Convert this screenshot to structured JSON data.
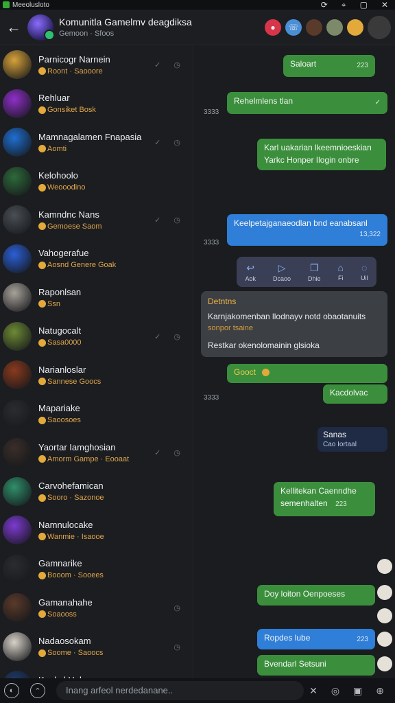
{
  "statusbar": {
    "app_title": "Meeolusloto"
  },
  "header": {
    "title": "Komunitla Gamelmv deagdiksa",
    "subtitle": "Gemoon · Sfoos",
    "back_icon": "arrow-left-icon"
  },
  "sidebar": {
    "chats": [
      {
        "name": "Parnicogr Narnein",
        "meta": "Roont · Saooore",
        "avatar": "#d7a23a",
        "time_icons": "✓ ◷"
      },
      {
        "name": "Rehluar",
        "meta": "Gonsiket Bosk",
        "avatar": "#8f2fc9",
        "time_icons": ""
      },
      {
        "name": "Mamnagalamen Fnapasia",
        "meta": "Aomti",
        "avatar": "#1f6fd1",
        "time_icons": "✓ ◷"
      },
      {
        "name": "Kelohoolo",
        "meta": "Weooodino",
        "avatar": "#2d6a3a",
        "time_icons": ""
      },
      {
        "name": "Kamndnc Nans",
        "meta": "Gemoese Saom",
        "avatar": "#4a4f55",
        "time_icons": "✓ ◷"
      },
      {
        "name": "Vahogerafue",
        "meta": "Aosnd Genere Goak",
        "avatar": "#2c5fd6",
        "time_icons": ""
      },
      {
        "name": "Raponlsan",
        "meta": "Ssn",
        "avatar": "#a8a29a",
        "time_icons": ""
      },
      {
        "name": "Natugocalt",
        "meta": "Sasa0000",
        "avatar": "#6d8a35",
        "time_icons": "✓ ◷"
      },
      {
        "name": "Narianloslar",
        "meta": "Sannese Goocs",
        "avatar": "#8a3a1e",
        "time_icons": ""
      },
      {
        "name": "Mapariake",
        "meta": "Saoosoes",
        "avatar": "#2a2c30",
        "time_icons": ""
      },
      {
        "name": "Yaortar Iamghosian",
        "meta": "Amorm Gampe · Eooaat",
        "avatar": "#3a2e2a",
        "time_icons": "✓ ◷"
      },
      {
        "name": "Carvohefamican",
        "meta": "Sooro · Sazonoe",
        "avatar": "#2f8f6a",
        "time_icons": ""
      },
      {
        "name": "Namnulocake",
        "meta": "Wanmie · Isaooe",
        "avatar": "#7d3ad1",
        "time_icons": ""
      },
      {
        "name": "Gamnarike",
        "meta": "Booom · Sooees",
        "avatar": "#2a2c30",
        "time_icons": ""
      },
      {
        "name": "Gamanahahe",
        "meta": "Soaooss",
        "avatar": "#5a3a2a",
        "time_icons": "◷"
      },
      {
        "name": "Nadaosokam",
        "meta": "Soome · Saoocs",
        "avatar": "#d8d2c8",
        "time_icons": "◷"
      },
      {
        "name": "Kaokal Hake",
        "meta": "",
        "avatar": "#1e3a6a",
        "time_icons": ""
      }
    ]
  },
  "conversation": {
    "messages": [
      {
        "text": "Saloart",
        "time": "223",
        "style": "green"
      },
      {
        "text": "Rehelmlens tlan",
        "time": "",
        "style": "green",
        "side_time": "3333"
      },
      {
        "text": "Karl uakarian lkeemnioeskian",
        "text2": "Yarkc Honper Ilogin onbre",
        "time": "",
        "style": "green"
      },
      {
        "text": "Keelpetajganaeodlan bnd eanabsanl",
        "time": "13,322",
        "style": "blue",
        "side_time": "3333"
      },
      {
        "text": "Gooct",
        "time": "",
        "style": "green"
      },
      {
        "text": "Kacdolvac",
        "time": "",
        "style": "green",
        "side_time": "3333"
      },
      {
        "text": "Sanas",
        "text2": "Cao Iortaal",
        "time": "",
        "style": "navy"
      },
      {
        "text": "Kellitekan Caenndhe",
        "text2": "semenhalten",
        "time": "223",
        "style": "green"
      },
      {
        "text": "Doy loiton Oenpoeses",
        "time": "",
        "style": "green"
      },
      {
        "text": "Ropdes lube",
        "time": "223",
        "style": "blue"
      },
      {
        "text": "Bvendarl Setsuni",
        "time": "",
        "style": "green"
      }
    ],
    "toolbar": [
      {
        "label": "Aok",
        "icon": "reply-icon",
        "glyph": "↩"
      },
      {
        "label": "Dcaoo",
        "icon": "forward-icon",
        "glyph": "▷"
      },
      {
        "label": "Dhie",
        "icon": "copy-icon",
        "glyph": "❐"
      },
      {
        "label": "Fi",
        "icon": "pin-icon",
        "glyph": "⌂"
      },
      {
        "label": "Uil",
        "icon": "delete-icon",
        "glyph": "◌"
      }
    ],
    "quote": {
      "title": "Detntns",
      "body": "Karnjakomenban llodnayv notd obaotanuits",
      "sub": "sonpor tsaine",
      "answer": "Restkar okenolomainin glsioka"
    }
  },
  "input": {
    "placeholder": "Inang arfeol nerdedanane..",
    "left_icons": [
      "mic-icon",
      "emoji-icon"
    ],
    "right_icons": [
      "sticker-icon",
      "attach-icon",
      "gif-icon",
      "send-icon"
    ]
  }
}
